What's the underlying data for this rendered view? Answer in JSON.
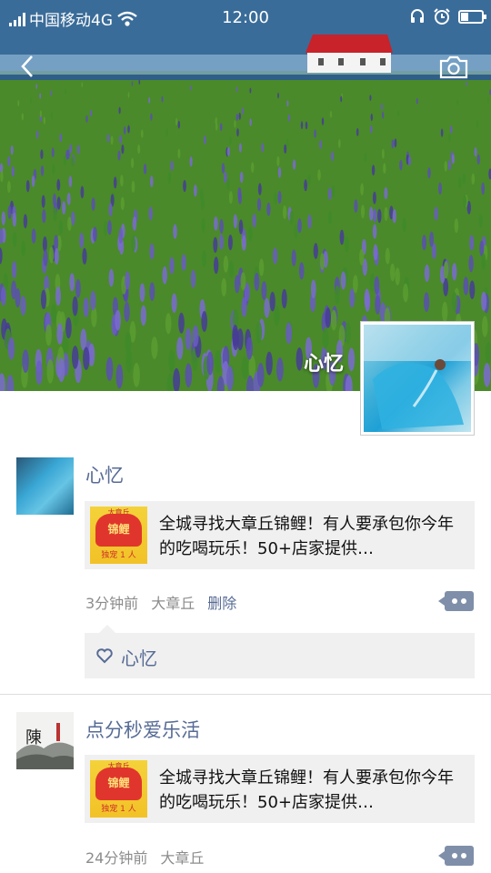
{
  "status_bar": {
    "carrier": "中国移动4G",
    "time": "12:00"
  },
  "cover": {
    "profile_name": "心忆"
  },
  "posts": [
    {
      "user": "心忆",
      "share_title": "全城寻找大章丘锦鲤！有人要承包你今年的吃喝玩乐！50+店家提供…",
      "thumb_badge": "锦鲤",
      "thumb_top": "大章丘",
      "thumb_bottom": "独宠 1 人",
      "time": "3分钟前",
      "location": "大章丘",
      "delete_label": "删除",
      "likes": [
        "心忆"
      ]
    },
    {
      "user": "点分秒爱乐活",
      "avatar_char": "陳",
      "share_title": "全城寻找大章丘锦鲤！有人要承包你今年的吃喝玩乐！50+店家提供…",
      "thumb_badge": "锦鲤",
      "thumb_top": "大章丘",
      "thumb_bottom": "独宠 1 人",
      "time": "24分钟前",
      "location": "大章丘"
    }
  ]
}
